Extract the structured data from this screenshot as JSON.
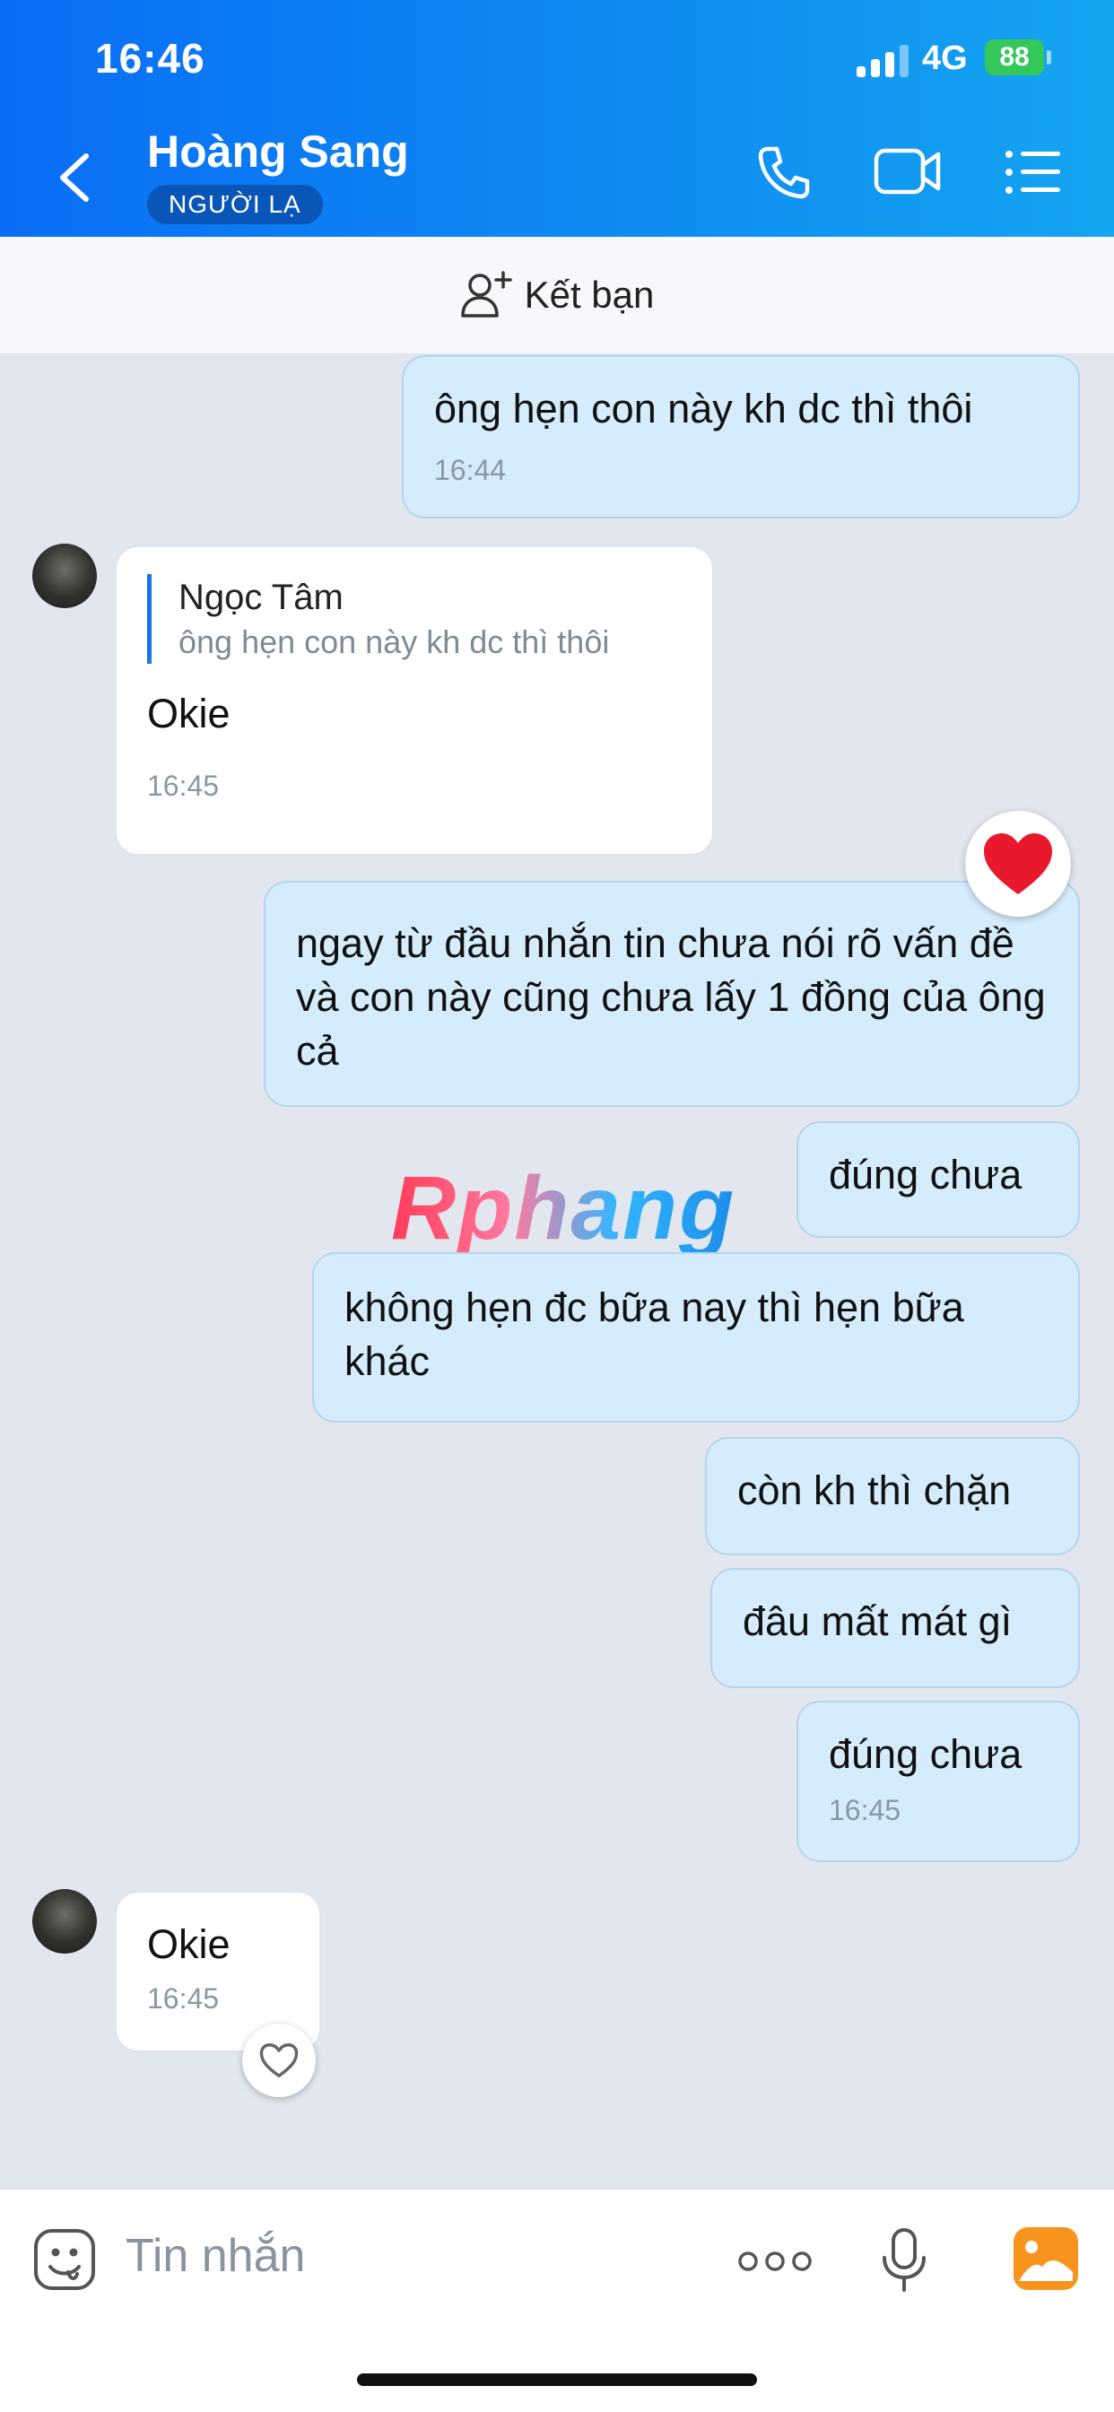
{
  "status": {
    "time": "16:46",
    "network": "4G",
    "battery": "88"
  },
  "header": {
    "contact_name": "Hoàng Sang",
    "badge": "NGƯỜI LẠ"
  },
  "add_friend": {
    "label": "Kết bạn"
  },
  "messages": [
    {
      "text": "ông hẹn con này kh dc thì thôi",
      "time": "16:44"
    },
    {
      "quote_name": "Ngọc Tâm",
      "quote_text": "ông hẹn con này kh dc thì thôi",
      "text": "Okie",
      "time": "16:45"
    },
    {
      "text": "ngay từ đầu nhắn tin chưa nói rõ vấn đề và con này cũng chưa lấy 1 đồng của ông cả"
    },
    {
      "text": "đúng chưa"
    },
    {
      "text": "không hẹn đc bữa nay thì hẹn bữa khác"
    },
    {
      "text": "còn kh thì chặn"
    },
    {
      "text": "đâu mất mát gì"
    },
    {
      "text": "đúng chưa",
      "time": "16:45"
    },
    {
      "text": "Okie",
      "time": "16:45"
    }
  ],
  "watermark": "Rphang",
  "composer": {
    "placeholder": "Tin nhắn"
  },
  "colors": {
    "header_start": "#0a6ef5",
    "header_end": "#14a5f0",
    "outgoing_bubble": "#d4ecfb",
    "background": "#e2e7ef"
  }
}
